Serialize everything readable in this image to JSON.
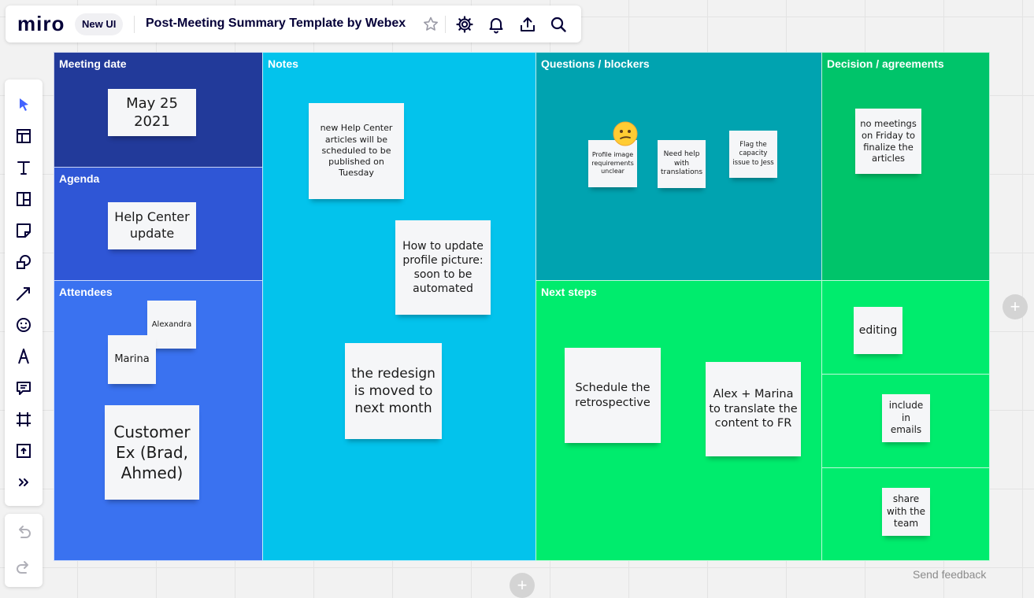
{
  "app": {
    "logo": "miro",
    "badge": "New UI"
  },
  "board": {
    "title": "Post-Meeting Summary Template by Webex"
  },
  "toolbar": {
    "tools": [
      "select-tool",
      "templates-tool",
      "text-tool",
      "card-tool",
      "sticky-note-tool",
      "shapes-tool",
      "pen-line-tool",
      "emoji-tool",
      "pen-tool",
      "comment-tool",
      "frame-tool",
      "upload-tool",
      "more-tools"
    ]
  },
  "sections": {
    "meeting_date": "Meeting date",
    "agenda": "Agenda",
    "attendees": "Attendees",
    "notes": "Notes",
    "questions": "Questions / blockers",
    "decisions": "Decision / agreements",
    "next_steps": "Next steps"
  },
  "stickies": {
    "date": "May 25 2021",
    "agenda": "Help Center update",
    "att_alexandra": "Alexandra",
    "att_marina": "Marina",
    "att_customer": "Customer Ex (Brad, Ahmed)",
    "note_1": "new Help Center articles will be scheduled to be published on Tuesday",
    "note_2": "How to update profile picture: soon to be automated",
    "note_3": "the redesign is moved to next month",
    "q_1": "Profile image requirements unclear",
    "q_2": "Need help with translations",
    "q_3": "Flag the capacity issue to Jess",
    "decision_1": "no meetings on Friday to finalize the articles",
    "next_1": "Schedule the retrospective",
    "next_2": "Alex + Marina to translate the content to FR",
    "side_1": "editing",
    "side_2": "include in emails",
    "side_3": "share with the team"
  },
  "colors": {
    "meeting_date": "#223a9a",
    "agenda": "#2f56d6",
    "attendees": "#3a72f0",
    "notes": "#03c3ec",
    "questions": "#00a3b0",
    "decisions": "#00c46a",
    "next_steps": "#00ec6d",
    "sticky": "#f5f6f8"
  },
  "footer": {
    "feedback": "Send feedback"
  }
}
